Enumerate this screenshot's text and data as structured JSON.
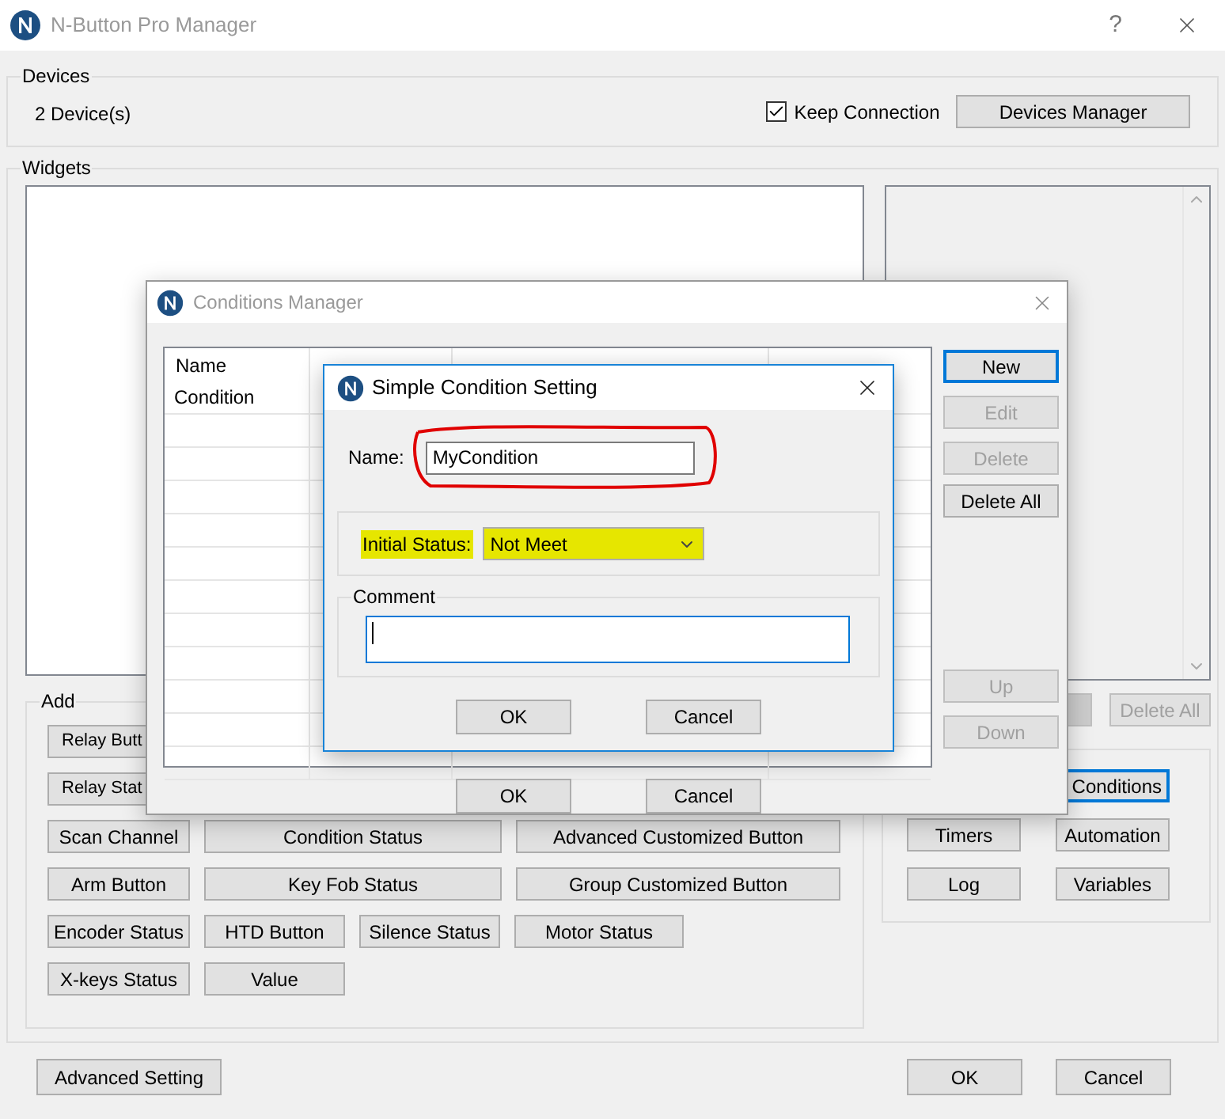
{
  "main_window": {
    "title": "N-Button Pro Manager",
    "help": "?"
  },
  "devices": {
    "title": "Devices",
    "count": "2 Device(s)",
    "keep_connection": {
      "label": "Keep Connection",
      "checked": true
    },
    "manager_button": "Devices Manager"
  },
  "widgets": {
    "title": "Widgets",
    "add": {
      "title": "Add",
      "rows": [
        [
          "Relay Butt"
        ],
        [
          "Relay Stat"
        ],
        [
          "Scan Channel",
          "Condition Status",
          "Advanced Customized Button"
        ],
        [
          "Arm Button",
          "Key Fob Status",
          "Group Customized Button"
        ],
        [
          "Encoder Status",
          "HTD Button",
          "Silence Status",
          "Motor Status"
        ],
        [
          "X-keys Status",
          "Value"
        ]
      ]
    },
    "list_buttons": [
      {
        "label": "Delete All",
        "disabled": true
      }
    ],
    "tools": [
      {
        "label": "Conditions",
        "focused": true
      },
      {
        "label": "Timers",
        "focused": false
      },
      {
        "label": "Automation",
        "focused": false
      },
      {
        "label": "Log",
        "focused": false
      },
      {
        "label": "Variables",
        "focused": false
      }
    ]
  },
  "footer_buttons": {
    "left": "Advanced Setting",
    "right": [
      "OK",
      "Cancel"
    ]
  },
  "conditions_manager": {
    "title": "Conditions Manager",
    "table": {
      "columns": [
        "Name"
      ],
      "rows": [
        [
          "Condition"
        ]
      ]
    },
    "side_buttons": [
      {
        "label": "New",
        "disabled": false,
        "focused": true
      },
      {
        "label": "Edit",
        "disabled": true,
        "focused": false
      },
      {
        "label": "Delete",
        "disabled": true,
        "focused": false
      },
      {
        "label": "Delete All",
        "disabled": false,
        "focused": false
      },
      {
        "label": "Up",
        "disabled": true,
        "focused": false
      },
      {
        "label": "Down",
        "disabled": true,
        "focused": false
      }
    ],
    "buttons": [
      "OK",
      "Cancel"
    ]
  },
  "simple_condition": {
    "title": "Simple Condition Setting",
    "name": {
      "label": "Name:",
      "value": "MyCondition",
      "circled": true
    },
    "initial_status": {
      "label": "Initial Status:",
      "value": "Not Meet",
      "highlighted": true
    },
    "comment": {
      "title": "Comment",
      "focused": true
    },
    "buttons": [
      "OK",
      "Cancel"
    ]
  }
}
